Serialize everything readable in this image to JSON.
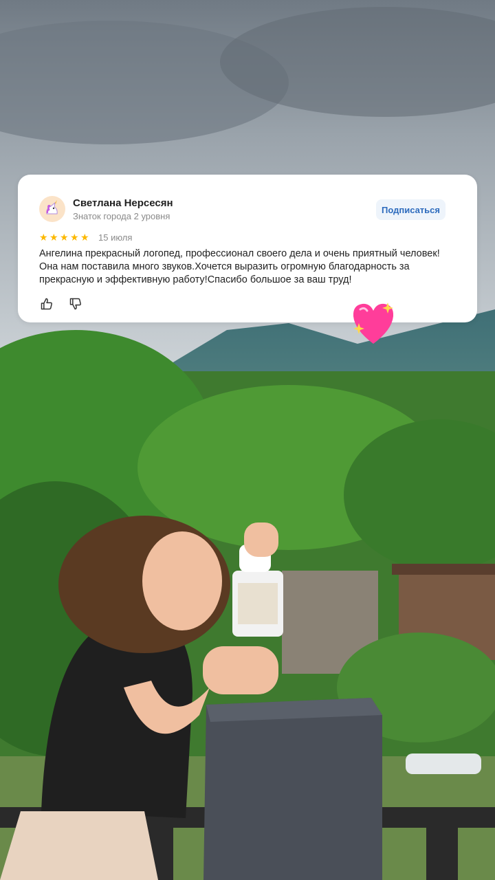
{
  "review": {
    "author_name": "Светлана Нерсесян",
    "author_level": "Знаток города 2 уровня",
    "subscribe_label": "Подписаться",
    "rating": 5,
    "date": "15 июля",
    "text": "Ангелина прекрасный логопед, профессионал своего дела и очень приятный человек! Она нам поставила много звуков.Хочется выразить огромную благодарность за прекрасную и эффективную работу!Спасибо большое за ваш труд!",
    "icons": {
      "avatar": "unicorn-icon",
      "like": "thumbs-up-icon",
      "dislike": "thumbs-down-icon"
    }
  },
  "decoration": {
    "emoji": "sparkling-heart-icon"
  },
  "colors": {
    "star": "#fcb800",
    "subscribe_bg": "#eef4fb",
    "subscribe_text": "#2d6bbd",
    "heart": "#ff3d9a"
  }
}
